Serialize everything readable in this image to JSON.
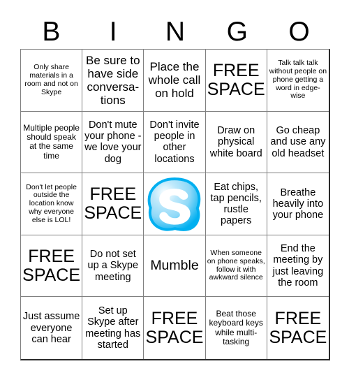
{
  "header": {
    "letters": [
      "B",
      "I",
      "N",
      "G",
      "O"
    ]
  },
  "card": {
    "title": "BINGO",
    "free_space_label": "FREE SPACE",
    "logo_name": "skype-logo",
    "logo_colors": {
      "primary": "#00aff0",
      "light": "#8fd9f8",
      "dark": "#0095d4",
      "letter": "#ffffff"
    }
  },
  "grid": {
    "rows": 5,
    "columns": 5,
    "cells": [
      {
        "text": "Only share materials in a room and not on Skype",
        "type": "text",
        "size": "xs"
      },
      {
        "text": "Be sure to have side conversa-\ntions",
        "type": "text",
        "size": "l"
      },
      {
        "text": "Place the whole call on hold",
        "type": "text",
        "size": "l"
      },
      {
        "text": "FREE SPACE",
        "type": "free",
        "size": "free"
      },
      {
        "text": "Talk talk talk without people on phone getting a word in edge-wise",
        "type": "text",
        "size": "xs"
      },
      {
        "text": "Multiple people should speak at the same time",
        "type": "text",
        "size": "s"
      },
      {
        "text": "Don't mute your phone - we love your dog",
        "type": "text",
        "size": "m"
      },
      {
        "text": "Don't invite people in other locations",
        "type": "text",
        "size": "m"
      },
      {
        "text": "Draw on physical white board",
        "type": "text",
        "size": "m"
      },
      {
        "text": "Go cheap and use any old headset",
        "type": "text",
        "size": "m"
      },
      {
        "text": "Don't let people outside the location know why everyone else is LOL!",
        "type": "text",
        "size": "xs"
      },
      {
        "text": "FREE SPACE",
        "type": "free",
        "size": "free"
      },
      {
        "text": "",
        "type": "logo",
        "size": "m"
      },
      {
        "text": "Eat chips, tap pencils, rustle papers",
        "type": "text",
        "size": "m"
      },
      {
        "text": "Breathe heavily into your phone",
        "type": "text",
        "size": "m"
      },
      {
        "text": "FREE SPACE",
        "type": "free",
        "size": "free"
      },
      {
        "text": "Do not set up a Skype meeting",
        "type": "text",
        "size": "m"
      },
      {
        "text": "Mumble",
        "type": "text",
        "size": "xl"
      },
      {
        "text": "When someone on phone speaks, follow it with awkward silence",
        "type": "text",
        "size": "xs"
      },
      {
        "text": "End the meeting by just leaving the room",
        "type": "text",
        "size": "m"
      },
      {
        "text": "Just assume everyone can hear",
        "type": "text",
        "size": "m"
      },
      {
        "text": "Set up Skype after meeting has started",
        "type": "text",
        "size": "m"
      },
      {
        "text": "FREE SPACE",
        "type": "free",
        "size": "free"
      },
      {
        "text": "Beat those keyboard keys while multi-tasking",
        "type": "text",
        "size": "s"
      },
      {
        "text": "FREE SPACE",
        "type": "free",
        "size": "free"
      }
    ]
  }
}
